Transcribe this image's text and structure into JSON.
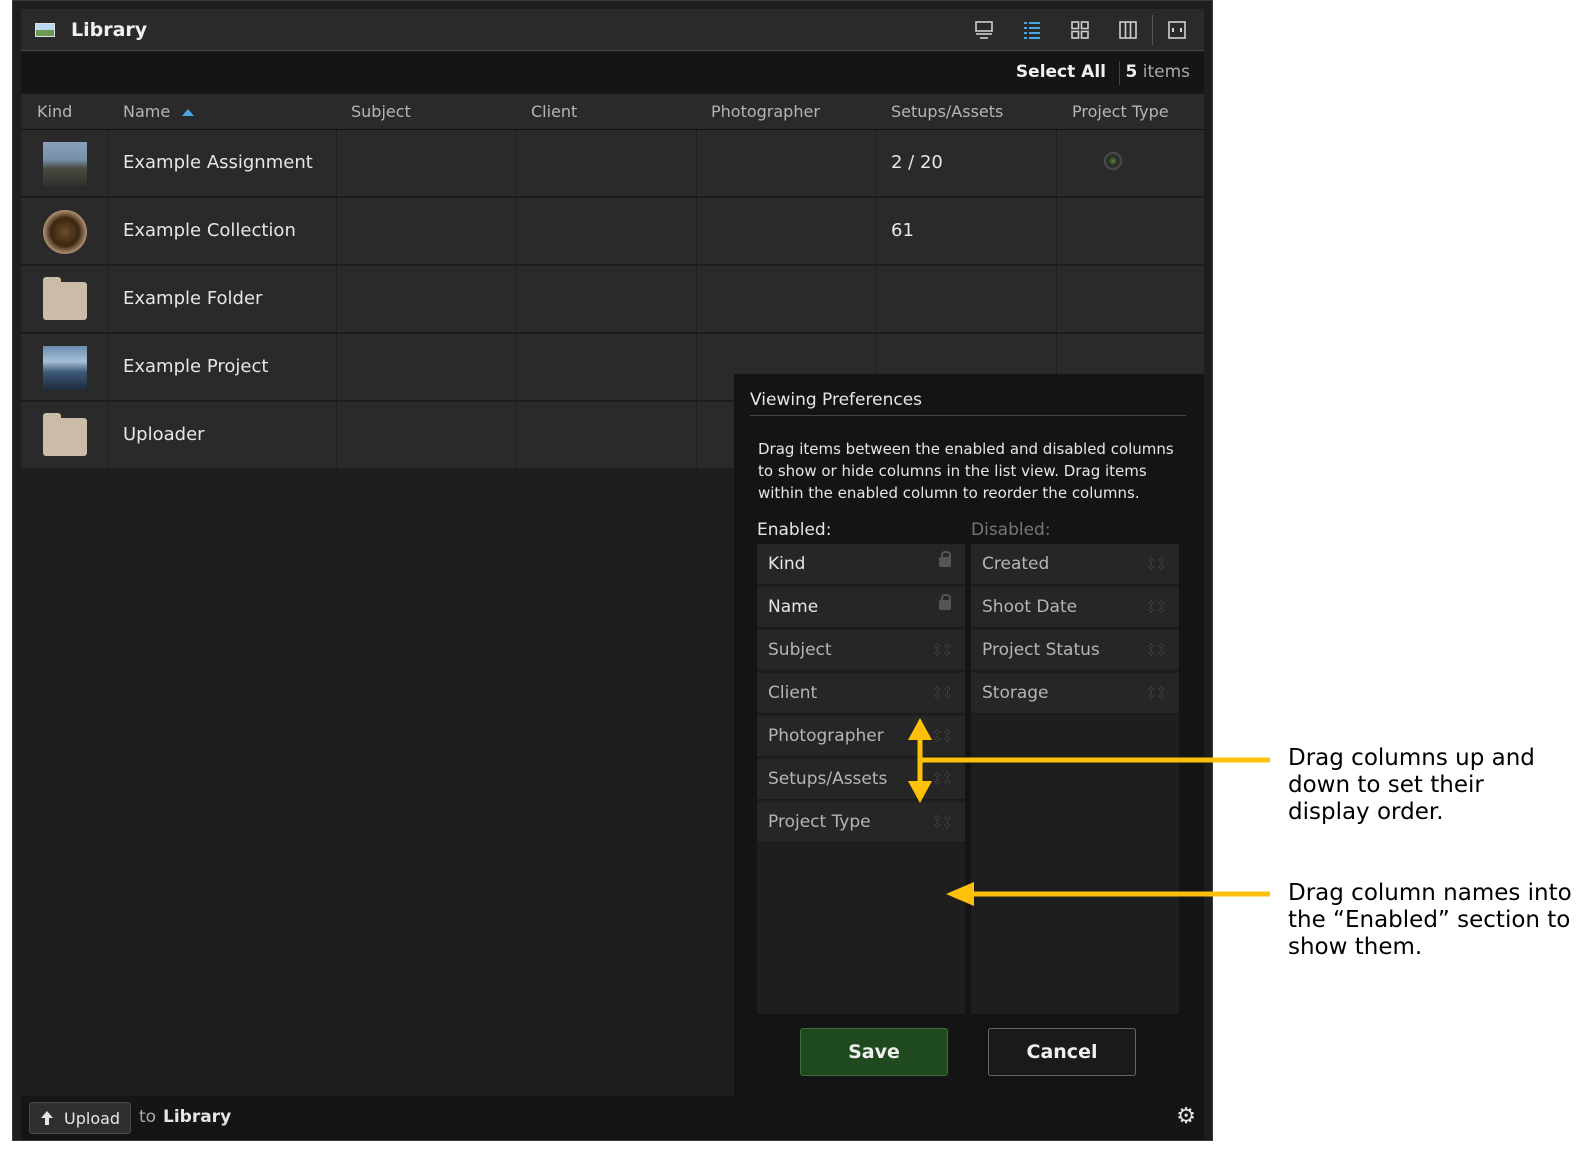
{
  "app": {
    "title": "Library",
    "select_all": "Select All",
    "item_count": "5",
    "item_count_label": " items"
  },
  "columns": [
    "Kind",
    "Name",
    "Subject",
    "Client",
    "Photographer",
    "Setups/Assets",
    "Project Type"
  ],
  "rows": [
    {
      "name": "Example Assignment",
      "kind_icon": "assignment-thumbnail",
      "setups": "2 / 20",
      "project_type_icon": "camera-lens-icon"
    },
    {
      "name": "Example Collection",
      "kind_icon": "collection-thumbnail",
      "setups": "61"
    },
    {
      "name": "Example Folder",
      "kind_icon": "folder-icon",
      "setups": ""
    },
    {
      "name": "Example Project",
      "kind_icon": "project-thumbnail",
      "setups": ""
    },
    {
      "name": "Uploader",
      "kind_icon": "folder-icon",
      "setups": ""
    }
  ],
  "prefs": {
    "title": "Viewing Preferences",
    "description": "Drag items between the enabled and disabled columns to show or hide columns in the list view. Drag items within the enabled column to reorder the columns.",
    "enabled_label": "Enabled:",
    "disabled_label": "Disabled:",
    "enabled": [
      {
        "label": "Kind",
        "locked": true
      },
      {
        "label": "Name",
        "locked": true
      },
      {
        "label": "Subject",
        "locked": false
      },
      {
        "label": "Client",
        "locked": false
      },
      {
        "label": "Photographer",
        "locked": false
      },
      {
        "label": "Setups/Assets",
        "locked": false
      },
      {
        "label": "Project Type",
        "locked": false
      }
    ],
    "disabled": [
      {
        "label": "Created"
      },
      {
        "label": "Shoot Date"
      },
      {
        "label": "Project Status"
      },
      {
        "label": "Storage"
      }
    ],
    "save": "Save",
    "cancel": "Cancel"
  },
  "bottom": {
    "upload": "Upload",
    "to": "to",
    "target": "Library"
  },
  "annotations": {
    "reorder": "Drag columns up and down to set their display order.",
    "enable": "Drag column names into the “Enabled” section to show them."
  },
  "colors": {
    "annotation_arrow": "#ffc107",
    "accent": "#49a7e8",
    "save_button": "#1f4a1e"
  }
}
